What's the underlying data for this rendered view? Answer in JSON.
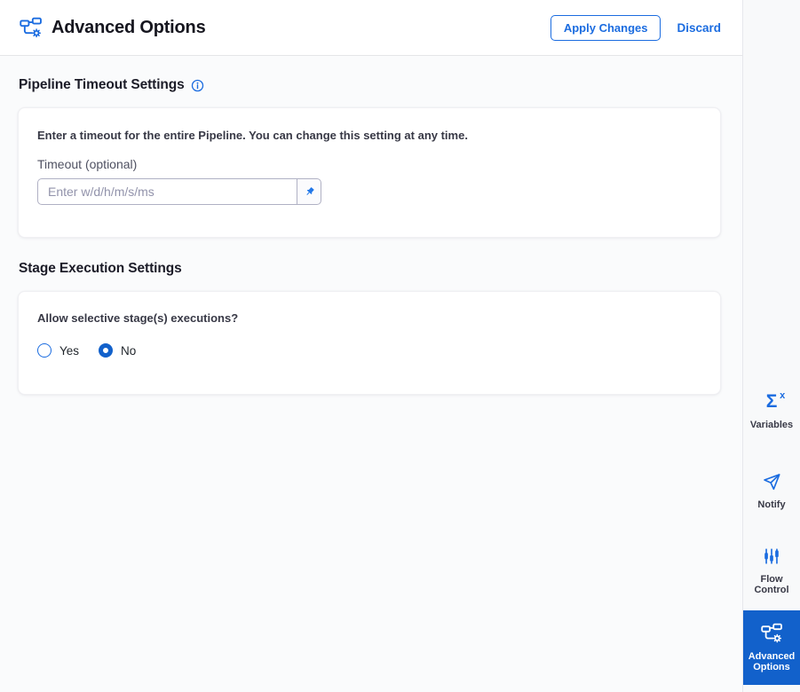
{
  "header": {
    "title": "Advanced Options",
    "apply_label": "Apply Changes",
    "discard_label": "Discard"
  },
  "pipeline_timeout": {
    "heading": "Pipeline Timeout Settings",
    "info_icon": "info-icon",
    "description": "Enter a timeout for the entire Pipeline. You can change this setting at any time.",
    "timeout_label": "Timeout (optional)",
    "timeout_placeholder": "Enter w/d/h/m/s/ms",
    "timeout_value": ""
  },
  "stage_execution": {
    "heading": "Stage Execution Settings",
    "question": "Allow selective stage(s) executions?",
    "options": [
      {
        "label": "Yes",
        "selected": false
      },
      {
        "label": "No",
        "selected": true
      }
    ]
  },
  "sidebar": {
    "items": [
      {
        "label": "Variables",
        "icon": "sigma-x-icon",
        "active": false
      },
      {
        "label": "Notify",
        "icon": "paper-plane-icon",
        "active": false
      },
      {
        "label": "Flow Control",
        "icon": "sliders-icon",
        "active": false
      },
      {
        "label": "Advanced Options",
        "icon": "pipeline-gear-icon",
        "active": true
      }
    ]
  },
  "colors": {
    "accent": "#1b6ce0",
    "active_nav_bg": "#1261cb",
    "content_bg": "#fafbfc",
    "sidebar_bg": "#f8f9fa"
  }
}
